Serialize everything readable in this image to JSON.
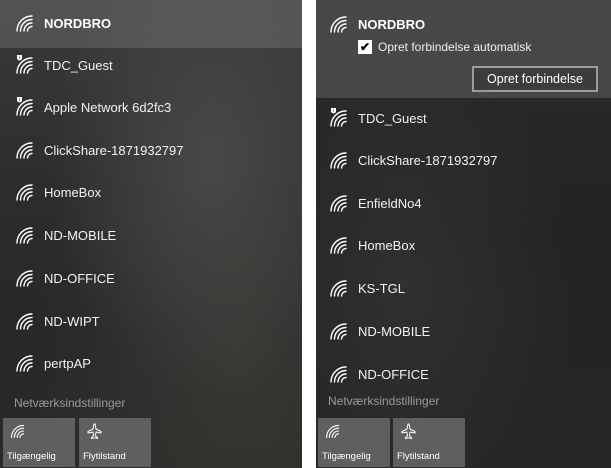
{
  "left_panel": {
    "selected": {
      "name": "NORDBRO"
    },
    "networks": [
      {
        "name": "TDC_Guest",
        "secured": false
      },
      {
        "name": "Apple Network 6d2fc3",
        "secured": false
      },
      {
        "name": "ClickShare-1871932797",
        "secured": true
      },
      {
        "name": "HomeBox",
        "secured": true
      },
      {
        "name": "ND-MOBILE",
        "secured": true
      },
      {
        "name": "ND-OFFICE",
        "secured": true
      },
      {
        "name": "ND-WIPT",
        "secured": true
      },
      {
        "name": "pertpAP",
        "secured": true
      }
    ],
    "settings_link": "Netværksindstillinger",
    "tiles": [
      {
        "label": "Tilgængelig",
        "icon": "wifi-icon"
      },
      {
        "label": "Flytilstand",
        "icon": "airplane-icon"
      }
    ]
  },
  "right_panel": {
    "selected": {
      "name": "NORDBRO",
      "auto_connect_label": "Opret forbindelse automatisk",
      "auto_connect_checked": true,
      "connect_button": "Opret forbindelse"
    },
    "networks": [
      {
        "name": "TDC_Guest",
        "secured": false
      },
      {
        "name": "ClickShare-1871932797",
        "secured": true
      },
      {
        "name": "EnfieldNo4",
        "secured": true
      },
      {
        "name": "HomeBox",
        "secured": true
      },
      {
        "name": "KS-TGL",
        "secured": true
      },
      {
        "name": "ND-MOBILE",
        "secured": true
      },
      {
        "name": "ND-OFFICE",
        "secured": true
      }
    ],
    "settings_link": "Netværksindstillinger",
    "tiles": [
      {
        "label": "Tilgængelig",
        "icon": "wifi-icon"
      },
      {
        "label": "Flytilstand",
        "icon": "airplane-icon"
      }
    ]
  },
  "colors": {
    "tile_bg": "#5e5f61",
    "settings_text": "#9a9a9a",
    "button_border": "#9c9c9c"
  }
}
